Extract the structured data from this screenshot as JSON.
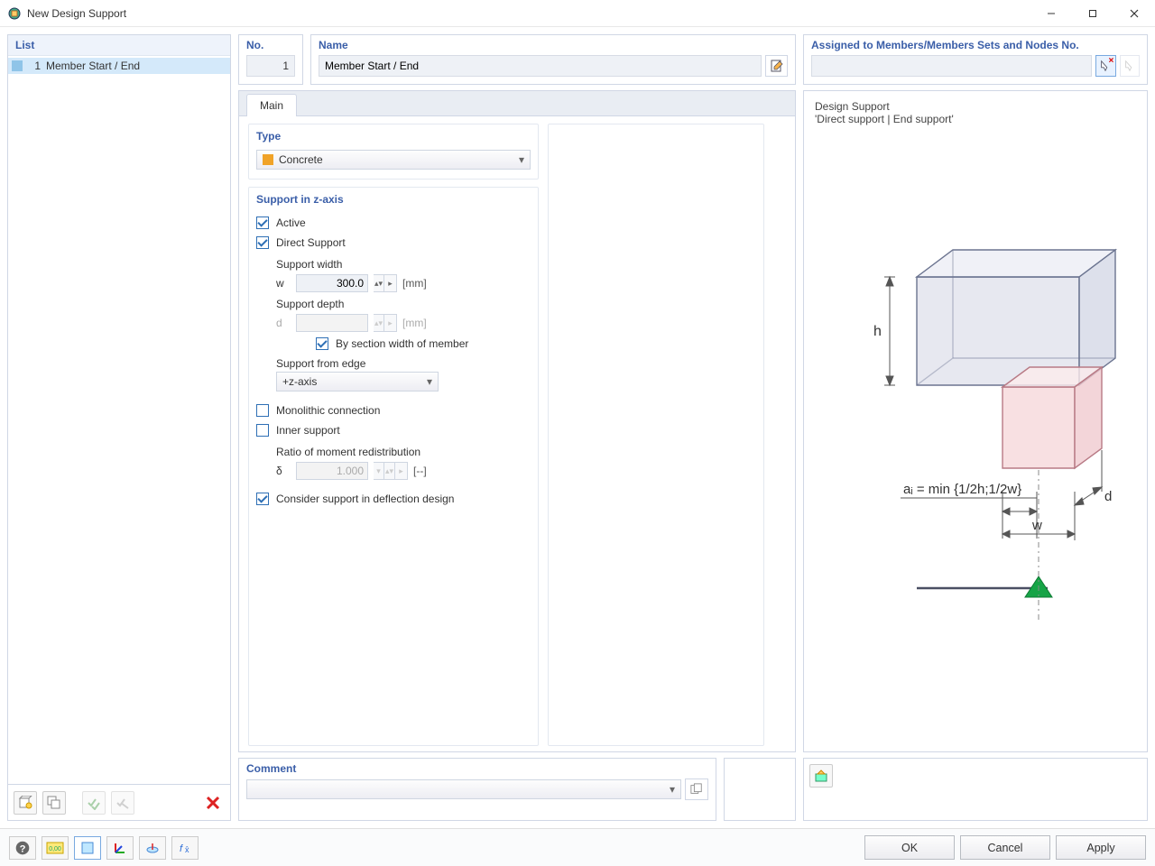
{
  "window": {
    "title": "New Design Support"
  },
  "list": {
    "heading": "List",
    "items": [
      {
        "index": "1",
        "label": "Member Start / End"
      }
    ]
  },
  "header": {
    "no_label": "No.",
    "no_value": "1",
    "name_label": "Name",
    "name_value": "Member Start / End",
    "assigned_label": "Assigned to Members/Members Sets and Nodes No.",
    "assigned_value": ""
  },
  "tabs": {
    "main": "Main"
  },
  "type": {
    "heading": "Type",
    "value": "Concrete"
  },
  "support_z": {
    "heading": "Support in z-axis",
    "active": "Active",
    "direct": "Direct Support",
    "width_label": "Support width",
    "width_sym": "w",
    "width_val": "300.0",
    "width_unit": "[mm]",
    "depth_label": "Support depth",
    "depth_sym": "d",
    "depth_val": "",
    "depth_unit": "[mm]",
    "by_section": "By section width of member",
    "edge_label": "Support from edge",
    "edge_value": "+z-axis",
    "mono": "Monolithic connection",
    "inner": "Inner support",
    "ratio_label": "Ratio of moment redistribution",
    "ratio_sym": "δ",
    "ratio_val": "1.000",
    "ratio_unit": "[--]",
    "deflection": "Consider support in deflection design"
  },
  "preview": {
    "title": "Design Support",
    "subtitle": "'Direct support | End support'",
    "annot_a": "aᵢ = min {1/2h;1/2w}",
    "annot_h": "h",
    "annot_w": "w",
    "annot_d": "d"
  },
  "comment": {
    "label": "Comment",
    "value": ""
  },
  "footer": {
    "ok": "OK",
    "cancel": "Cancel",
    "apply": "Apply"
  }
}
